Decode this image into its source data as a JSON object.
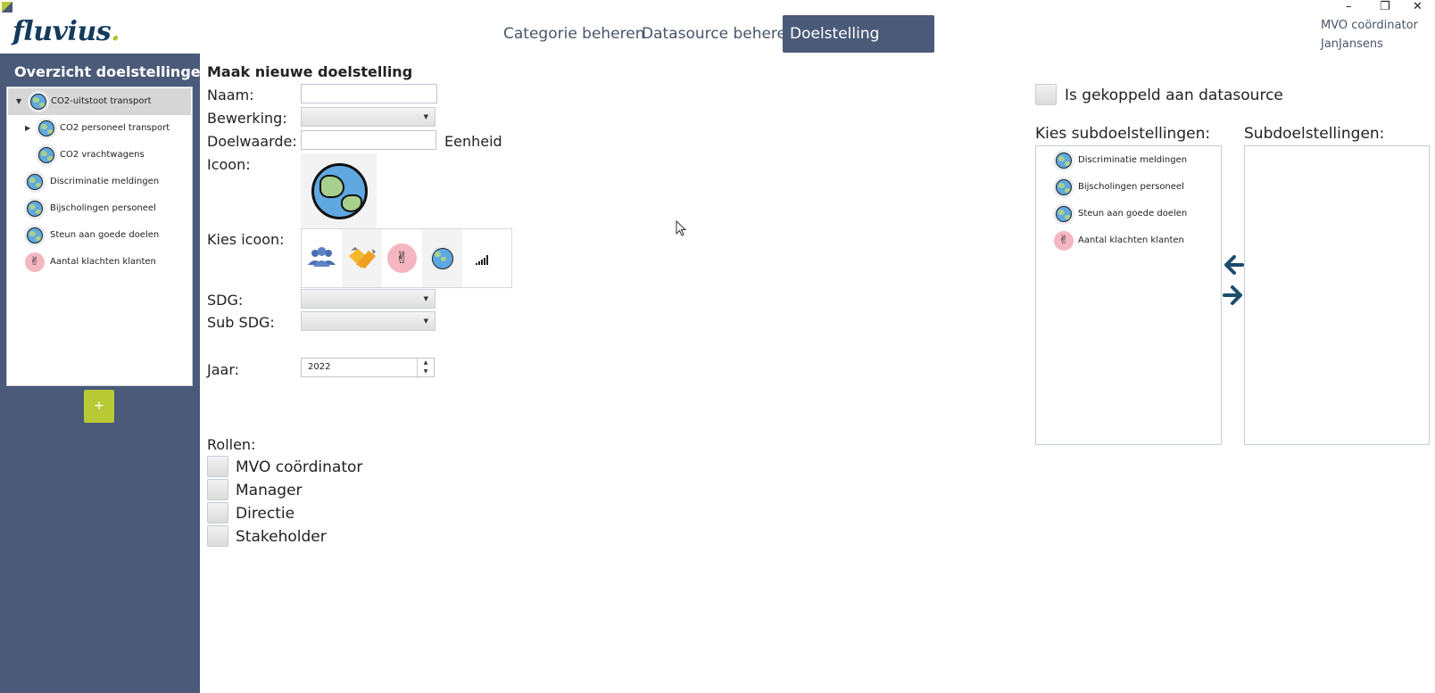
{
  "window": {
    "minimize": "–",
    "restore": "❐",
    "close": "✕"
  },
  "brand": {
    "logo_text": "fluvius",
    "logo_dot": "."
  },
  "nav": {
    "tabs": [
      {
        "label": "Categorie beheren",
        "active": false
      },
      {
        "label": "Datasource beheren",
        "active": false
      },
      {
        "label": "Doelstelling beheren",
        "active": true
      }
    ]
  },
  "user": {
    "role": "MVO coördinator",
    "name": "JanJansens"
  },
  "sidebar": {
    "title": "Overzicht doelstellingen",
    "add_label": "+",
    "items": [
      {
        "label": "CO2-uitstoot transport",
        "icon": "globe-icon",
        "expanded": true,
        "selected": true
      },
      {
        "label": "CO2 personeel transport",
        "icon": "globe-icon",
        "collapsed": true
      },
      {
        "label": "CO2 vrachtwagens",
        "icon": "globe-icon"
      },
      {
        "label": "Discriminatie meldingen",
        "icon": "globe-icon"
      },
      {
        "label": "Bijscholingen personeel",
        "icon": "globe-icon"
      },
      {
        "label": "Steun aan goede doelen",
        "icon": "globe-icon"
      },
      {
        "label": "Aantal klachten klanten",
        "icon": "peace-hand-icon"
      }
    ]
  },
  "form": {
    "title": "Maak nieuwe doelstelling",
    "naam_label": "Naam:",
    "naam_value": "",
    "bewerking_label": "Bewerking:",
    "bewerking_value": "",
    "doelwaarde_label": "Doelwaarde:",
    "doelwaarde_value": "",
    "eenheid_label": "Eenheid",
    "icoon_label": "Icoon:",
    "kies_icoon_label": "Kies icoon:",
    "icon_options": [
      "people-icon",
      "handshake-icon",
      "peace-hand-icon",
      "globe-icon",
      "signal-bars-icon"
    ],
    "sdg_label": "SDG:",
    "sdg_value": "",
    "subsdg_label": "Sub SDG:",
    "subsdg_value": "",
    "jaar_label": "Jaar:",
    "jaar_value": "2022",
    "rollen_label": "Rollen:",
    "rollen": [
      "MVO coördinator",
      "Manager",
      "Directie",
      "Stakeholder"
    ]
  },
  "right": {
    "datasource_label": "Is gekoppeld aan datasource",
    "kies_sub_label": "Kies subdoelstellingen:",
    "sub_label": "Subdoelstellingen:",
    "available": [
      {
        "label": "Discriminatie meldingen",
        "icon": "globe-icon"
      },
      {
        "label": "Bijscholingen personeel",
        "icon": "globe-icon"
      },
      {
        "label": "Steun aan goede doelen",
        "icon": "globe-icon"
      },
      {
        "label": "Aantal klachten klanten",
        "icon": "peace-hand-icon"
      }
    ],
    "selected": [],
    "arrow_left": "🡸",
    "arrow_right": "🡺"
  },
  "colors": {
    "sidebar": "#4a5a78",
    "accent": "#b7c934",
    "active_tab": "#4a5a78",
    "arrow": "#1c4c6c"
  }
}
